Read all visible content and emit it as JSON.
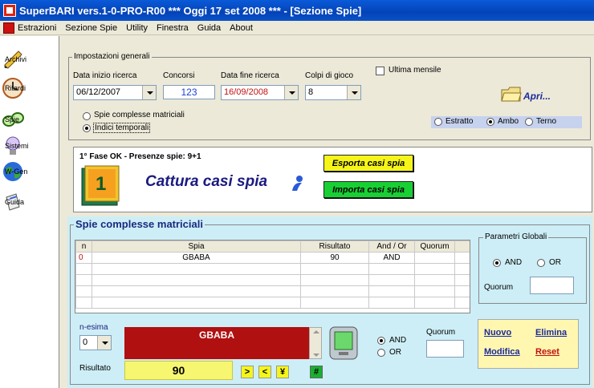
{
  "window": {
    "title": "SuperBARI vers.1-0-PRO-R00  ***  Oggi 17 set 2008  ***   - [Sezione Spie]"
  },
  "menu": [
    "Estrazioni",
    "Sezione Spie",
    "Utility",
    "Finestra",
    "Guida",
    "About"
  ],
  "sidebar": [
    {
      "label": "Archivi",
      "icon": "pencil-icon"
    },
    {
      "label": "Ritardi",
      "icon": "clock-icon"
    },
    {
      "label": "Spie",
      "icon": "glasses-icon"
    },
    {
      "label": "Sistemi",
      "icon": "lightbulb-icon"
    },
    {
      "label": "W-Gen",
      "icon": "globe-icon"
    },
    {
      "label": "Guida",
      "icon": "book-icon"
    }
  ],
  "settings": {
    "group_title": "Impostazioni generali",
    "start_date_label": "Data inizio ricerca",
    "start_date": "06/12/2007",
    "contests_label": "Concorsi",
    "contests": "123",
    "end_date_label": "Data fine ricerca",
    "end_date": "16/09/2008",
    "shots_label": "Colpi di gioco",
    "shots": "8",
    "last_monthly_label": "Ultima mensile",
    "open_label": "Apri...",
    "mode_options": [
      "Spie complesse matriciali",
      "Indici temporali"
    ],
    "mode_selected": 1,
    "play_options": [
      "Estratto",
      "Ambo",
      "Terno"
    ],
    "play_selected": 1
  },
  "capture": {
    "phase_text": "1° Fase OK - Presenze spie: 9+1",
    "badge": "1",
    "title": "Cattura casi spia",
    "export_label": "Esporta casi spia",
    "import_label": "Importa casi spia"
  },
  "matrix": {
    "title": "Spie complesse matriciali",
    "columns": [
      "n",
      "Spia",
      "Risultato",
      "And / Or",
      "Quorum"
    ],
    "rows": [
      [
        "0",
        "GBABA",
        "90",
        "AND",
        ""
      ]
    ],
    "global_title": "Parametri Globali",
    "global_options": [
      "AND",
      "OR"
    ],
    "global_selected": 0,
    "global_quorum_label": "Quorum",
    "nth_label": "n-esima",
    "nth_value": "0",
    "editor_text": "GBABA",
    "result_label": "Risultato",
    "result_value": "90",
    "nav_buttons": [
      ">",
      "<",
      "¥"
    ],
    "hash_button": "#",
    "local_options": [
      "AND",
      "OR"
    ],
    "local_selected": 0,
    "local_quorum_label": "Quorum",
    "actions": {
      "new": "Nuovo",
      "delete": "Elimina",
      "edit": "Modifica",
      "reset": "Reset"
    }
  }
}
